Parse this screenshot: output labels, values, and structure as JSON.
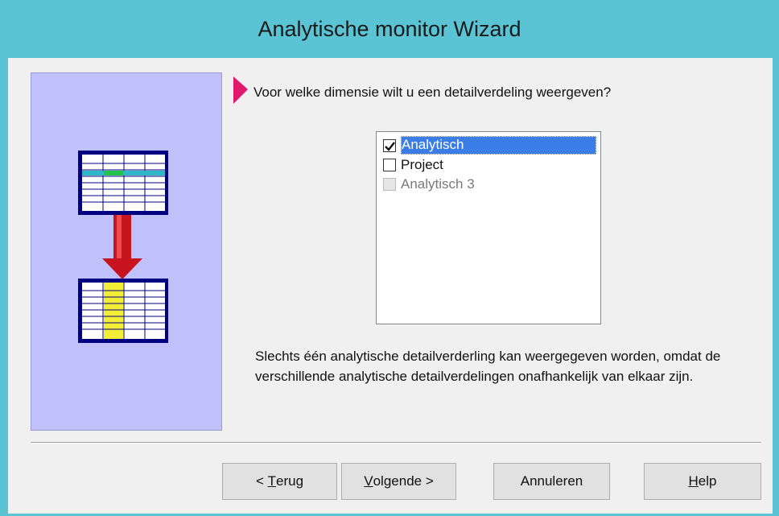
{
  "window": {
    "title": "Analytische monitor Wizard"
  },
  "question": "Voor welke dimensie wilt u een detailverdeling weergeven?",
  "dimensions": [
    {
      "label": "Analytisch",
      "checked": true,
      "selected": true,
      "enabled": true
    },
    {
      "label": "Project",
      "checked": false,
      "selected": false,
      "enabled": true
    },
    {
      "label": "Analytisch 3",
      "checked": false,
      "selected": false,
      "enabled": false
    }
  ],
  "explanation": "Slechts één analytische detailverderling kan weergegeven worden, omdat de verschillende analytische detailverdelingen onafhankelijk van elkaar zijn.",
  "buttons": {
    "back": {
      "prefix": "< ",
      "mnemonic": "T",
      "rest": "erug"
    },
    "next": {
      "mnemonic": "V",
      "rest": "olgende >"
    },
    "cancel": {
      "label": "Annuleren"
    },
    "help": {
      "mnemonic": "H",
      "rest": "elp"
    }
  },
  "colors": {
    "title_bar": "#5bc4d4",
    "side_panel": "#c0c0fb",
    "pointer": "#e0186c",
    "selection": "#3b7de6"
  }
}
